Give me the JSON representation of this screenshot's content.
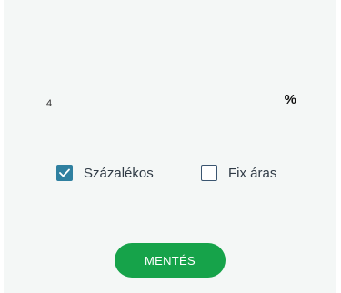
{
  "form": {
    "value_field": {
      "value": "4",
      "unit": "%"
    },
    "options": {
      "percent": {
        "label": "Százalékos",
        "checked": true
      },
      "fixed": {
        "label": "Fix áras",
        "checked": false
      }
    },
    "save_label": "MENTÉS"
  },
  "colors": {
    "panel_bg": "#f4f7f6",
    "checkbox_checked": "#2f80a0",
    "save_button": "#16a34a",
    "underline": "#2e4a66"
  },
  "icons": {
    "checked": "checkmark-icon"
  }
}
